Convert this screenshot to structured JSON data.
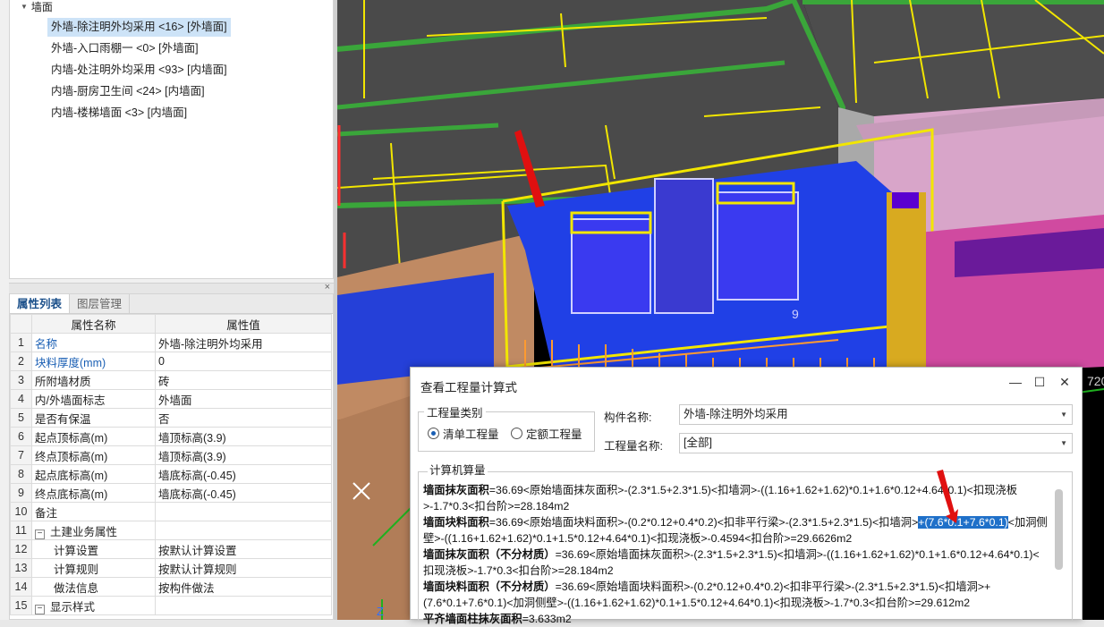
{
  "tree": {
    "root_label": "墙面",
    "items": [
      "外墙-除注明外均采用 <16> [外墙面]",
      "外墙-入口雨棚一 <0> [外墙面]",
      "内墙-处注明外均采用 <93> [内墙面]",
      "内墙-厨房卫生间 <24> [内墙面]",
      "内墙-楼梯墙面 <3> [内墙面]"
    ]
  },
  "props": {
    "tabs": [
      "属性列表",
      "图层管理"
    ],
    "header": {
      "name": "属性名称",
      "value": "属性值"
    },
    "rows": [
      {
        "n": "1",
        "name": "名称",
        "value": "外墙-除注明外均采用"
      },
      {
        "n": "2",
        "name": "块料厚度(mm)",
        "value": "0"
      },
      {
        "n": "3",
        "name": "所附墙材质",
        "value": "砖"
      },
      {
        "n": "4",
        "name": "内/外墙面标志",
        "value": "外墙面"
      },
      {
        "n": "5",
        "name": "是否有保温",
        "value": "否"
      },
      {
        "n": "6",
        "name": "起点顶标高(m)",
        "value": "墙顶标高(3.9)"
      },
      {
        "n": "7",
        "name": "终点顶标高(m)",
        "value": "墙顶标高(3.9)"
      },
      {
        "n": "8",
        "name": "起点底标高(m)",
        "value": "墙底标高(-0.45)"
      },
      {
        "n": "9",
        "name": "终点底标高(m)",
        "value": "墙底标高(-0.45)"
      },
      {
        "n": "10",
        "name": "备注",
        "value": ""
      },
      {
        "n": "11",
        "name": "土建业务属性",
        "value": ""
      },
      {
        "n": "12",
        "name": "计算设置",
        "value": "按默认计算设置"
      },
      {
        "n": "13",
        "name": "计算规则",
        "value": "按默认计算规则"
      },
      {
        "n": "14",
        "name": "做法信息",
        "value": "按构件做法"
      },
      {
        "n": "15",
        "name": "显示样式",
        "value": ""
      }
    ]
  },
  "viewport": {
    "labels": [
      "720",
      "9",
      "Z"
    ]
  },
  "dialog": {
    "title": "查看工程量计算式",
    "group_label": "工程量类别",
    "radio_list": "清单工程量",
    "radio_quota": "定额工程量",
    "component_label": "构件名称:",
    "component_value": "外墙-除注明外均采用",
    "quantity_label": "工程量名称:",
    "quantity_value": "[全部]",
    "calc_label": "计算机算量",
    "lines": {
      "l1_bold": "墙面抹灰面积",
      "l1_rest": "=36.69<原始墙面抹灰面积>-(2.3*1.5+2.3*1.5)<扣墙洞>-((1.16+1.62+1.62)*0.1+1.6*0.12+4.64*0.1)<扣现浇板>-1.7*0.3<扣台阶>=28.184m2",
      "l2_bold": "墙面块料面积",
      "l2_a": "=36.69<原始墙面块料面积>-(0.2*0.12+0.4*0.2)<扣非平行梁>-(2.3*1.5+2.3*1.5)<扣墙洞>",
      "l2_hl": "+(7.6*0.1+7.6*0.1)",
      "l2_b": "<加洞侧壁>-((1.16+1.62+1.62)*0.1+1.5*0.12+4.64*0.1)<扣现浇板>-0.4594<扣台阶>=29.6626m2",
      "l3_bold": "墙面抹灰面积（不分材质）",
      "l3_rest": "=36.69<原始墙面抹灰面积>-(2.3*1.5+2.3*1.5)<扣墙洞>-((1.16+1.62+1.62)*0.1+1.6*0.12+4.64*0.1)<扣现浇板>-1.7*0.3<扣台阶>=28.184m2",
      "l4_bold": "墙面块料面积（不分材质）",
      "l4_rest": "=36.69<原始墙面块料面积>-(0.2*0.12+0.4*0.2)<扣非平行梁>-(2.3*1.5+2.3*1.5)<扣墙洞>+(7.6*0.1+7.6*0.1)<加洞侧壁>-((1.16+1.62+1.62)*0.1+1.5*0.12+4.64*0.1)<扣现浇板>-1.7*0.3<扣台阶>=29.612m2",
      "l5_bold": "平齐墙面柱抹灰面积",
      "l5_rest": "=3.633m2"
    }
  }
}
